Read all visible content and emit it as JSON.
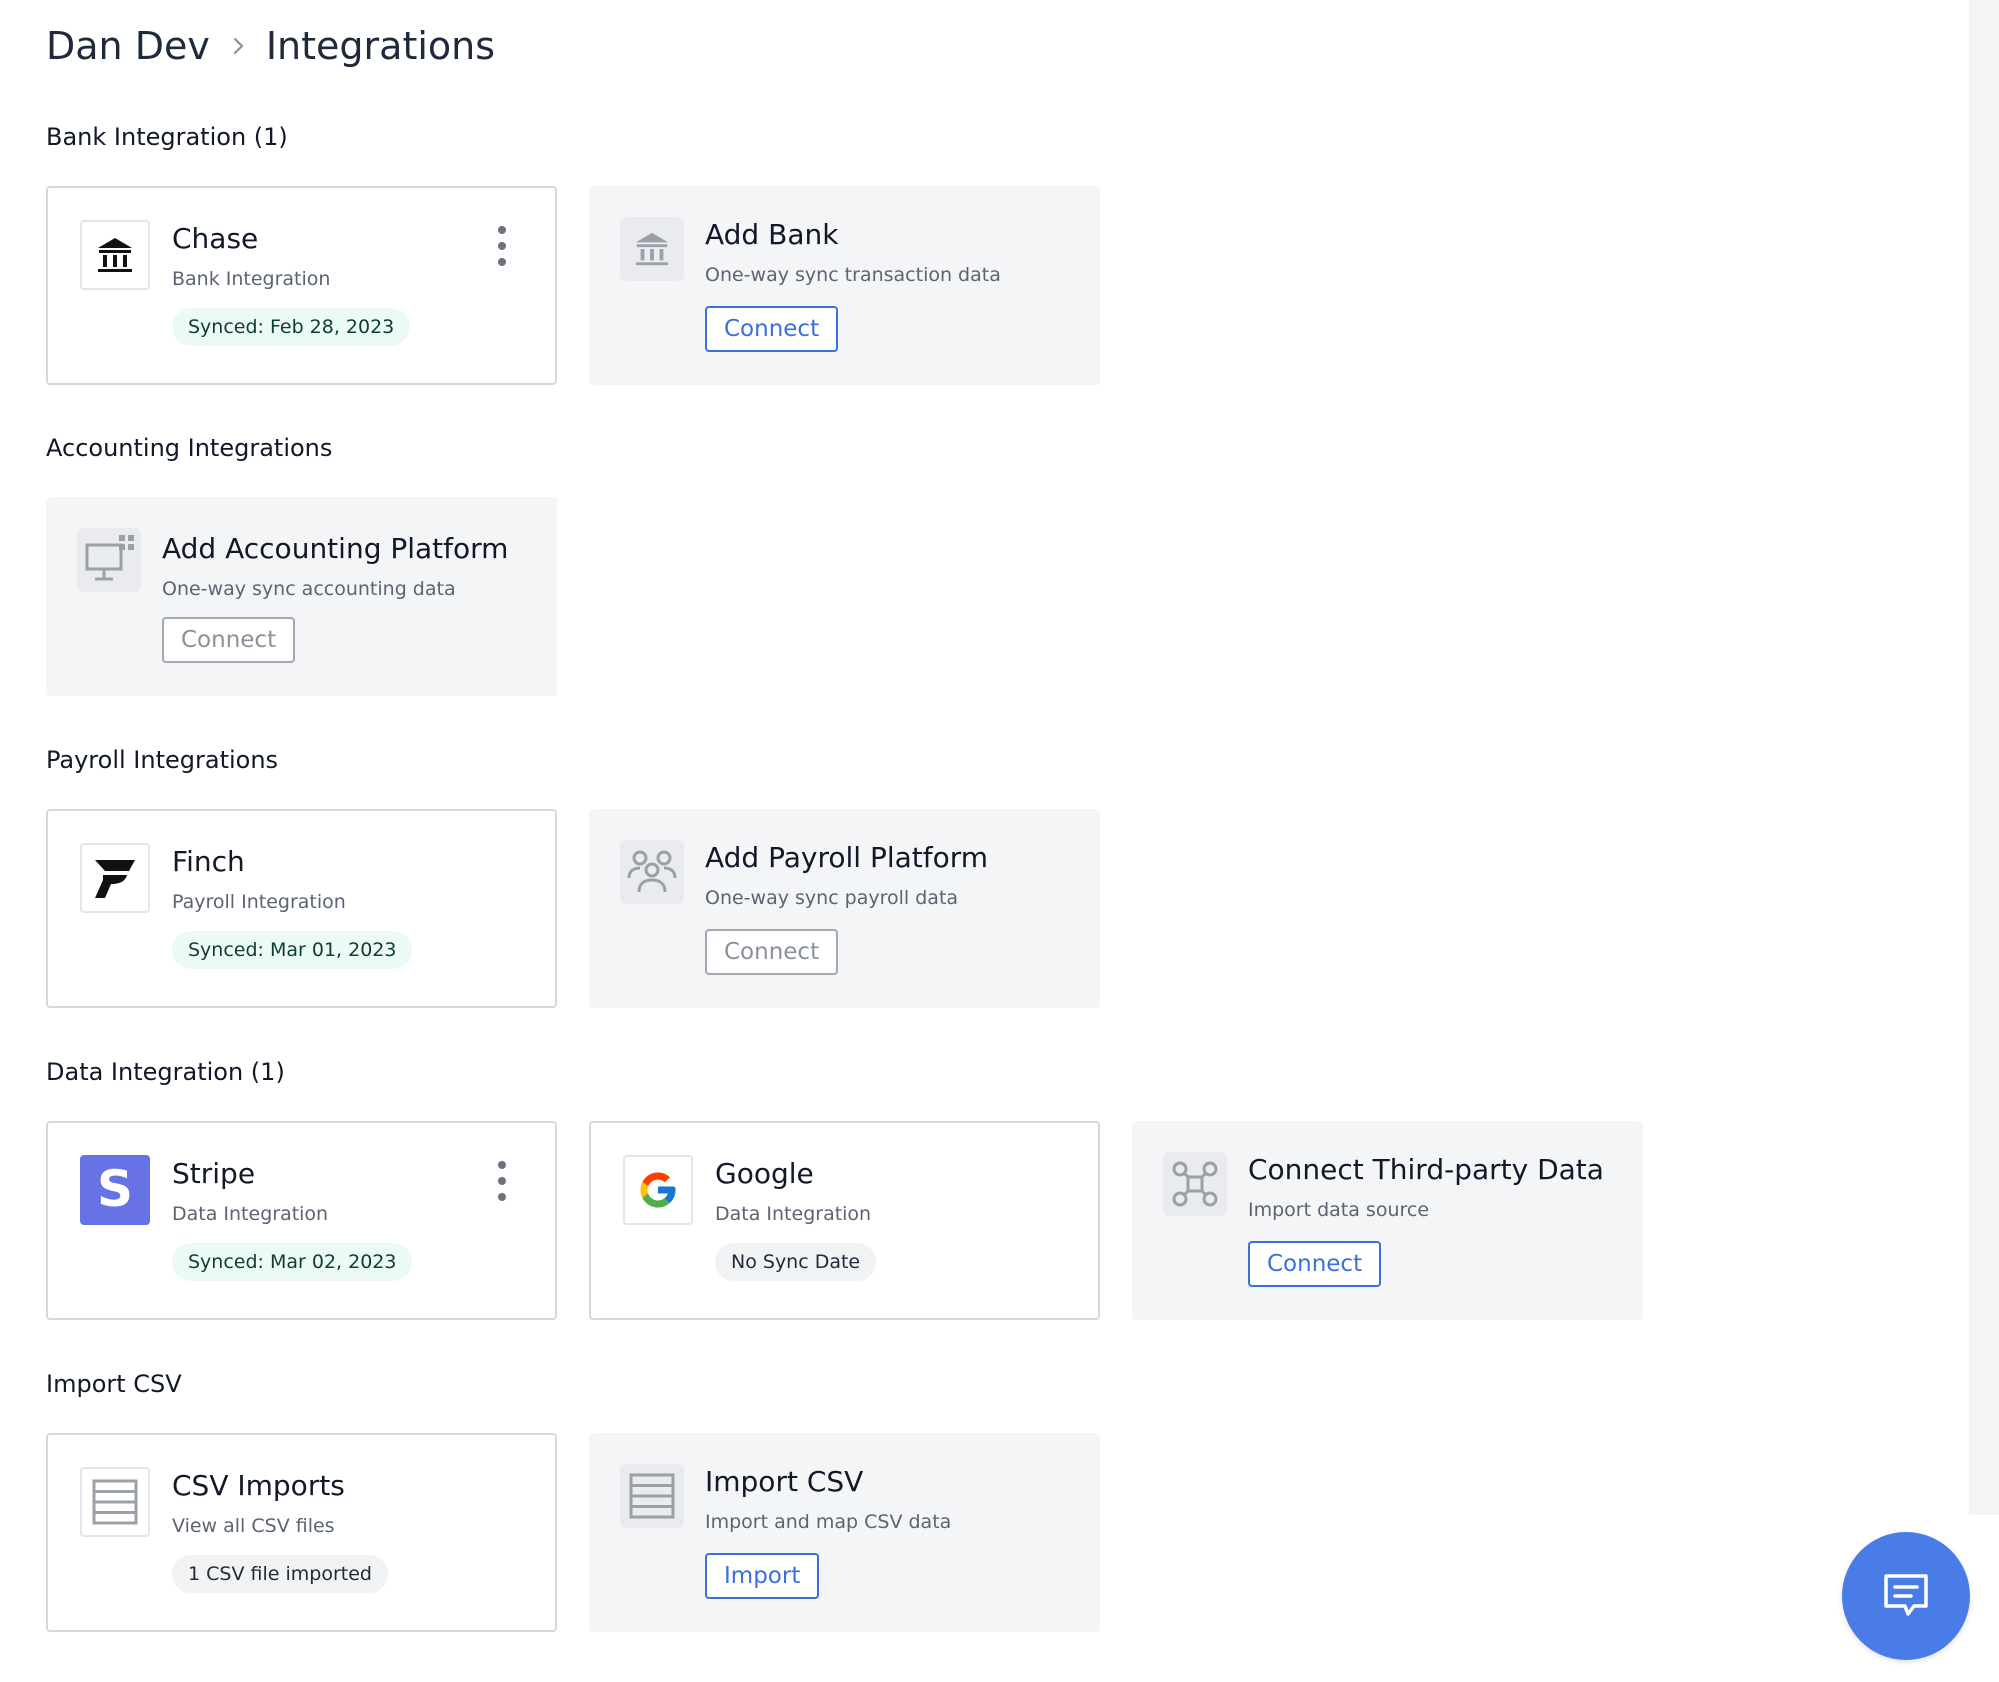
{
  "breadcrumb": {
    "parent": "Dan Dev",
    "current": "Integrations"
  },
  "sections": {
    "bank": {
      "title": "Bank Integration (1)",
      "existing": {
        "name": "Chase",
        "type": "Bank Integration",
        "status": "Synced: Feb 28, 2023",
        "icon": "bank-icon"
      },
      "add": {
        "title": "Add Bank",
        "subtitle": "One-way sync transaction data",
        "button": "Connect",
        "icon": "bank-icon"
      }
    },
    "accounting": {
      "title": "Accounting Integrations",
      "add": {
        "title": "Add Accounting Platform",
        "subtitle": "One-way sync accounting data",
        "button": "Connect",
        "icon": "monitor-icon"
      }
    },
    "payroll": {
      "title": "Payroll Integrations",
      "existing": {
        "name": "Finch",
        "type": "Payroll Integration",
        "status": "Synced: Mar 01, 2023",
        "icon": "finch-logo"
      },
      "add": {
        "title": "Add Payroll Platform",
        "subtitle": "One-way sync payroll data",
        "button": "Connect",
        "icon": "users-icon"
      }
    },
    "data": {
      "title": "Data Integration (1)",
      "stripe": {
        "name": "Stripe",
        "type": "Data Integration",
        "status": "Synced: Mar 02, 2023",
        "logo_letter": "S",
        "icon": "stripe-logo"
      },
      "google": {
        "name": "Google",
        "type": "Data Integration",
        "status": "No Sync Date",
        "icon": "google-logo"
      },
      "add": {
        "title": "Connect Third-party Data",
        "subtitle": "Import data source",
        "button": "Connect",
        "icon": "network-icon"
      }
    },
    "csv": {
      "title": "Import CSV",
      "existing": {
        "name": "CSV Imports",
        "subtitle": "View all CSV files",
        "status": "1 CSV file imported",
        "icon": "table-icon"
      },
      "add": {
        "title": "Import CSV",
        "subtitle": "Import and map CSV data",
        "button": "Import",
        "icon": "table-icon"
      }
    }
  },
  "colors": {
    "primary": "#3b6fdb",
    "synced_badge_bg": "#ecfaf5",
    "stripe_brand": "#6772e5",
    "chat_button": "#4a7ce8"
  },
  "chat": {
    "icon": "chat-icon"
  }
}
